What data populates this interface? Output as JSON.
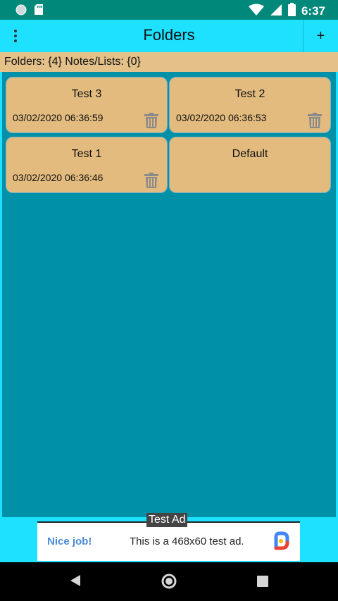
{
  "status": {
    "time": "6:37",
    "icons": [
      "notification-circle-icon",
      "sd-card-icon",
      "wifi-icon",
      "cell-signal-icon",
      "battery-icon"
    ]
  },
  "appbar": {
    "title": "Folders",
    "add_label": "+",
    "menu_icon": "overflow-menu-icon"
  },
  "infobar": {
    "text": "Folders: {4} Notes/Lists: {0}"
  },
  "folders": [
    {
      "name": "Test 3",
      "date": "03/02/2020 06:36:59"
    },
    {
      "name": "Test 2",
      "date": "03/02/2020 06:36:53"
    },
    {
      "name": "Test 1",
      "date": "03/02/2020 06:36:46"
    },
    {
      "name": "Default",
      "date": ""
    }
  ],
  "ad": {
    "tag": "Test Ad",
    "nice": "Nice job!",
    "message": "This is a 468x60 test ad."
  },
  "colors": {
    "appbar": "#1ee0ff",
    "content": "#0090a8",
    "card": "#e3bb7e",
    "infobar": "#e3c189",
    "statusbar": "#00897b"
  }
}
